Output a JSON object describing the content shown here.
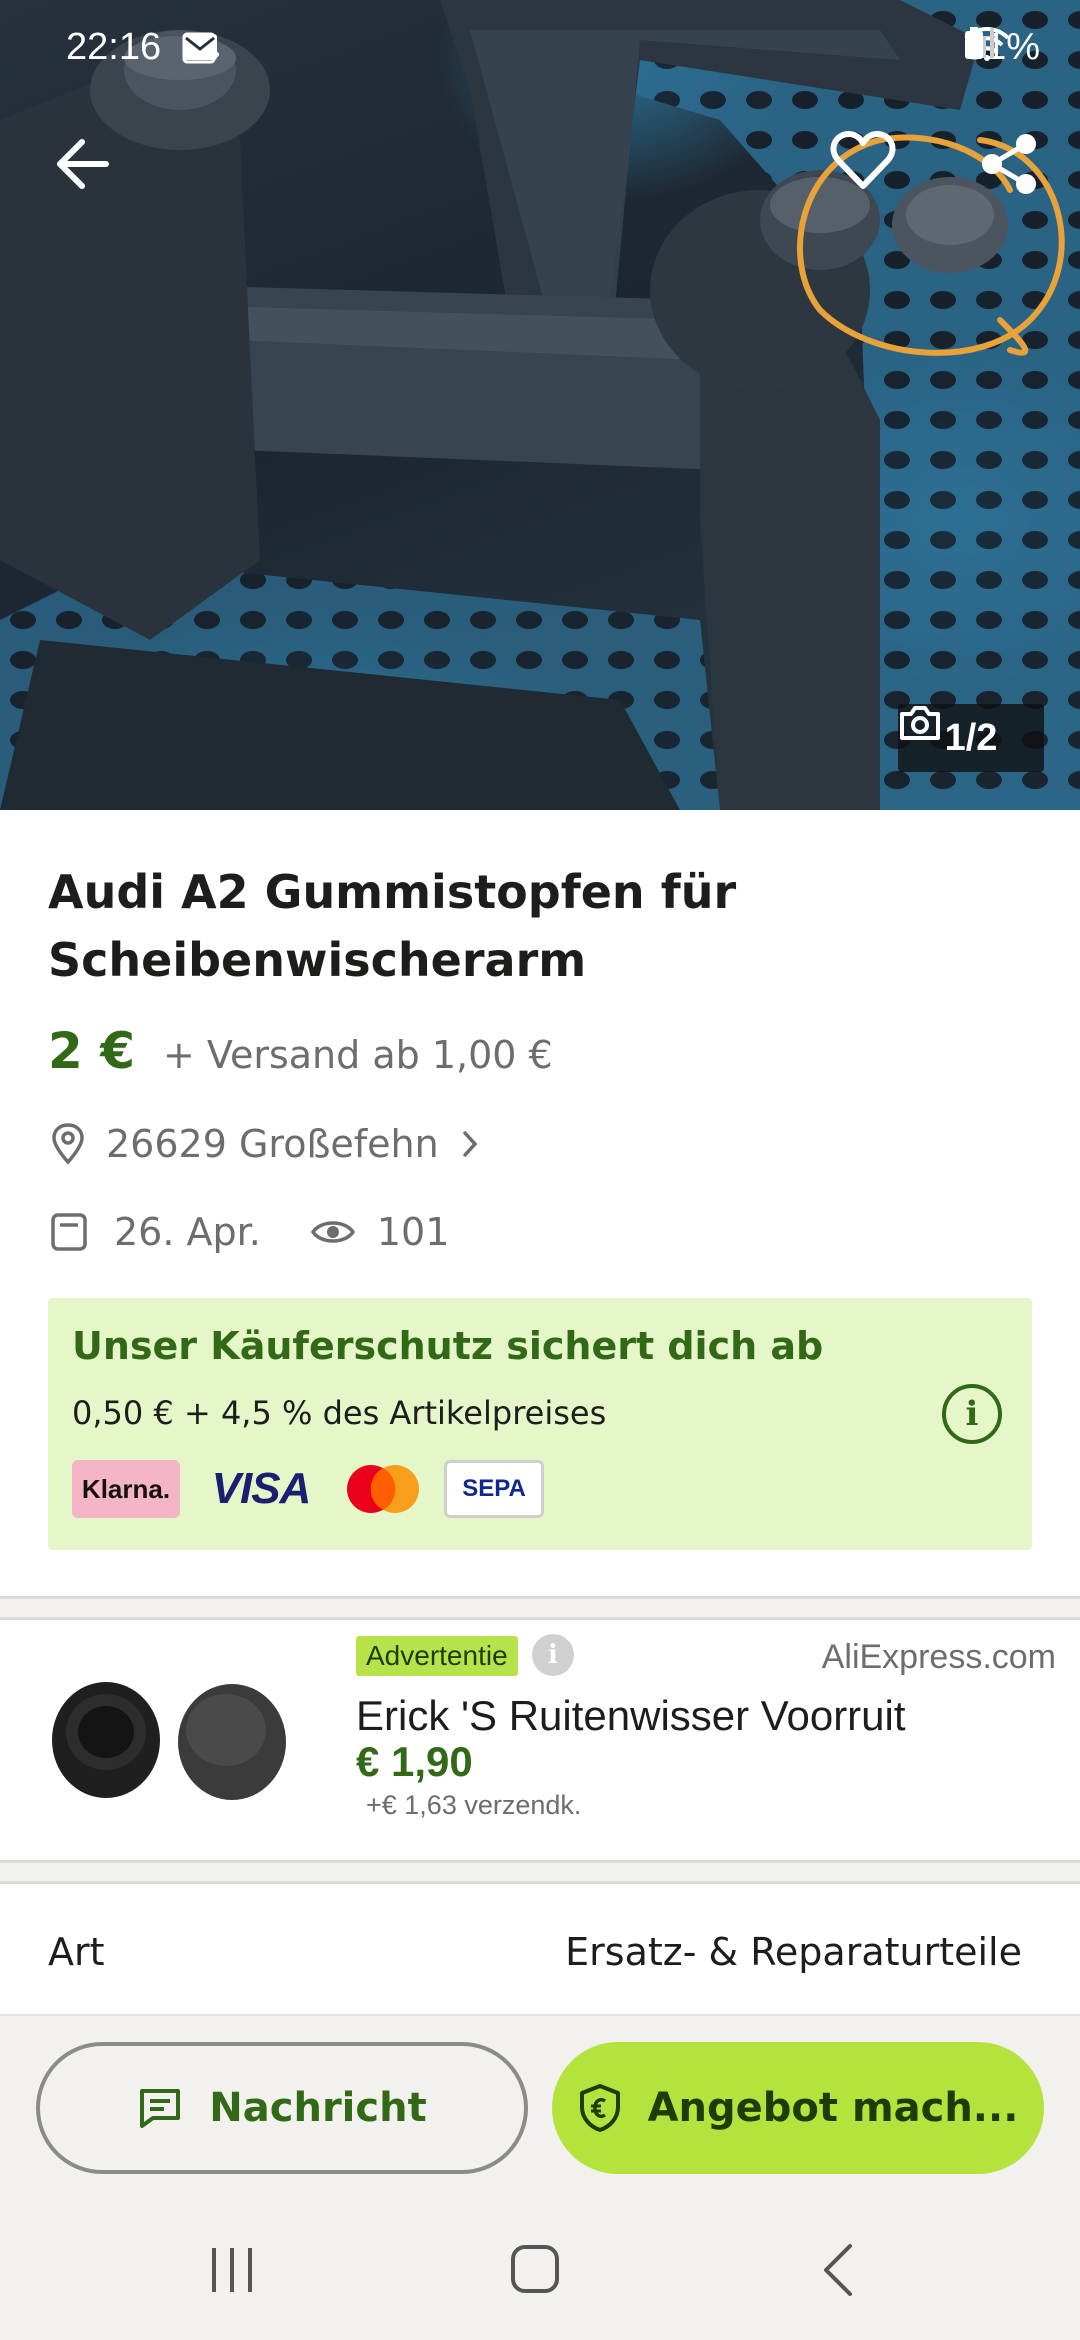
{
  "status_bar": {
    "time": "22:16",
    "battery": "81%",
    "icons": [
      "gallery-icon",
      "cloud-icon",
      "mail-icon",
      "wifi-icon",
      "signal-icon",
      "battery-icon"
    ]
  },
  "gallery": {
    "counter": "1/2",
    "icons": [
      "back-arrow-icon",
      "heart-icon",
      "share-icon",
      "camera-icon"
    ]
  },
  "listing": {
    "title": "Audi A2 Gummistopfen für Scheibenwischerarm",
    "price": "2 €",
    "shipping": "+ Versand ab 1,00 €",
    "location": "26629 Großefehn",
    "date": "26. Apr.",
    "views": "101"
  },
  "buyer_protection": {
    "title": "Unser Käuferschutz sichert dich ab",
    "subtitle": "0,50 € + 4,5 % des Artikelpreises",
    "payment_methods": {
      "klarna": "Klarna.",
      "visa": "VISA",
      "mastercard": "",
      "sepa": "SEPA"
    }
  },
  "ad": {
    "badge": "Advertentie",
    "source": "AliExpress.com",
    "title": "Erick 'S Ruitenwisser Voorruit",
    "price": "€ 1,90",
    "shipping": "+€ 1,63 verzendk."
  },
  "attributes": [
    {
      "key": "Art",
      "value": "Ersatz- & Reparaturteile"
    }
  ],
  "actions": {
    "message": "Nachricht",
    "offer": "Angebot mach..."
  },
  "colors": {
    "brand_green": "#326916",
    "accent_lime": "#b4e33d",
    "protection_bg": "#e5f6c8",
    "annotation_orange": "#e7a23a"
  }
}
